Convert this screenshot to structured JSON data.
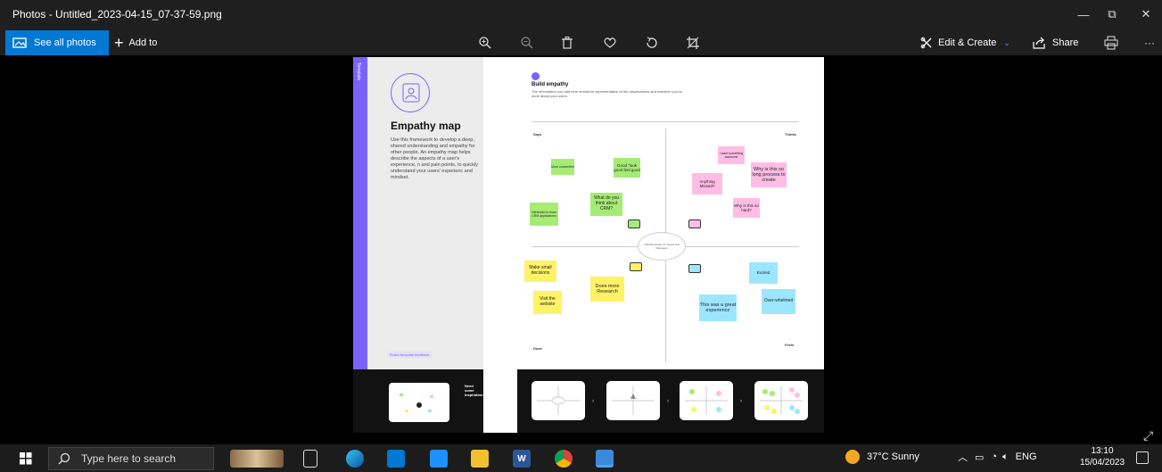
{
  "window": {
    "title": "Photos - Untitled_2023-04-15_07-37-59.png",
    "minimize_glyph": "—",
    "maximize_glyph": "⧉",
    "close_glyph": "✕"
  },
  "toolbar": {
    "see_all_label": "See all photos",
    "add_to_label": "Add to",
    "edit_create_label": "Edit & Create",
    "share_label": "Share",
    "more_glyph": "···",
    "accent_color": "#0078d4",
    "icons": [
      "zoom-in-icon",
      "zoom-out-icon",
      "delete-icon",
      "favorite-heart-icon",
      "rotate-icon",
      "crop-icon",
      "print-icon"
    ]
  },
  "photo": {
    "template_tag": "Template",
    "title": "Empathy map",
    "description": "Use this framework to develop a deep, shared understanding and empathy for other people. An empathy map helps describe the aspects of a user's experience, n and pain points, to quickly understand your users' experienc and mindset.",
    "share_link": "Share template feedback",
    "build_title": "Build empathy",
    "build_desc": "The information you add here should be representative of the observations and research you've done about your users.",
    "quadrants": {
      "says": "Says",
      "thinks": "Thinks",
      "does": "Does",
      "feels": "Feels"
    },
    "center": "CRM Bootstrap for Clients and Managers",
    "notes": {
      "n1": "More convenient",
      "n2": "Good \"look good feel good",
      "n3": "What do you think about CRM?",
      "n4": "Interested to learn CRM applications",
      "n5": "I want something awesome",
      "n6": "Why is this so long process to create",
      "n7": "Anything Missed?",
      "n8": "Why is this so hard?",
      "n9": "Make small decisions",
      "n10": "Does more Research",
      "n11": "Visit the website",
      "n12": "Excited",
      "n13": "This was a great experience",
      "n14": "Over-whelmed"
    },
    "footer_teaser": "Need some inspiration?",
    "note_colors": {
      "green": "#a6ec74",
      "pink": "#ffbde5",
      "yellow": "#fff266",
      "blue": "#9ce6ff",
      "purple": "#7b61ff"
    }
  },
  "taskbar": {
    "search_placeholder": "Type here to search",
    "weather": "37°C  Sunny",
    "language": "ENG",
    "time": "13:10",
    "date": "15/04/2023"
  }
}
